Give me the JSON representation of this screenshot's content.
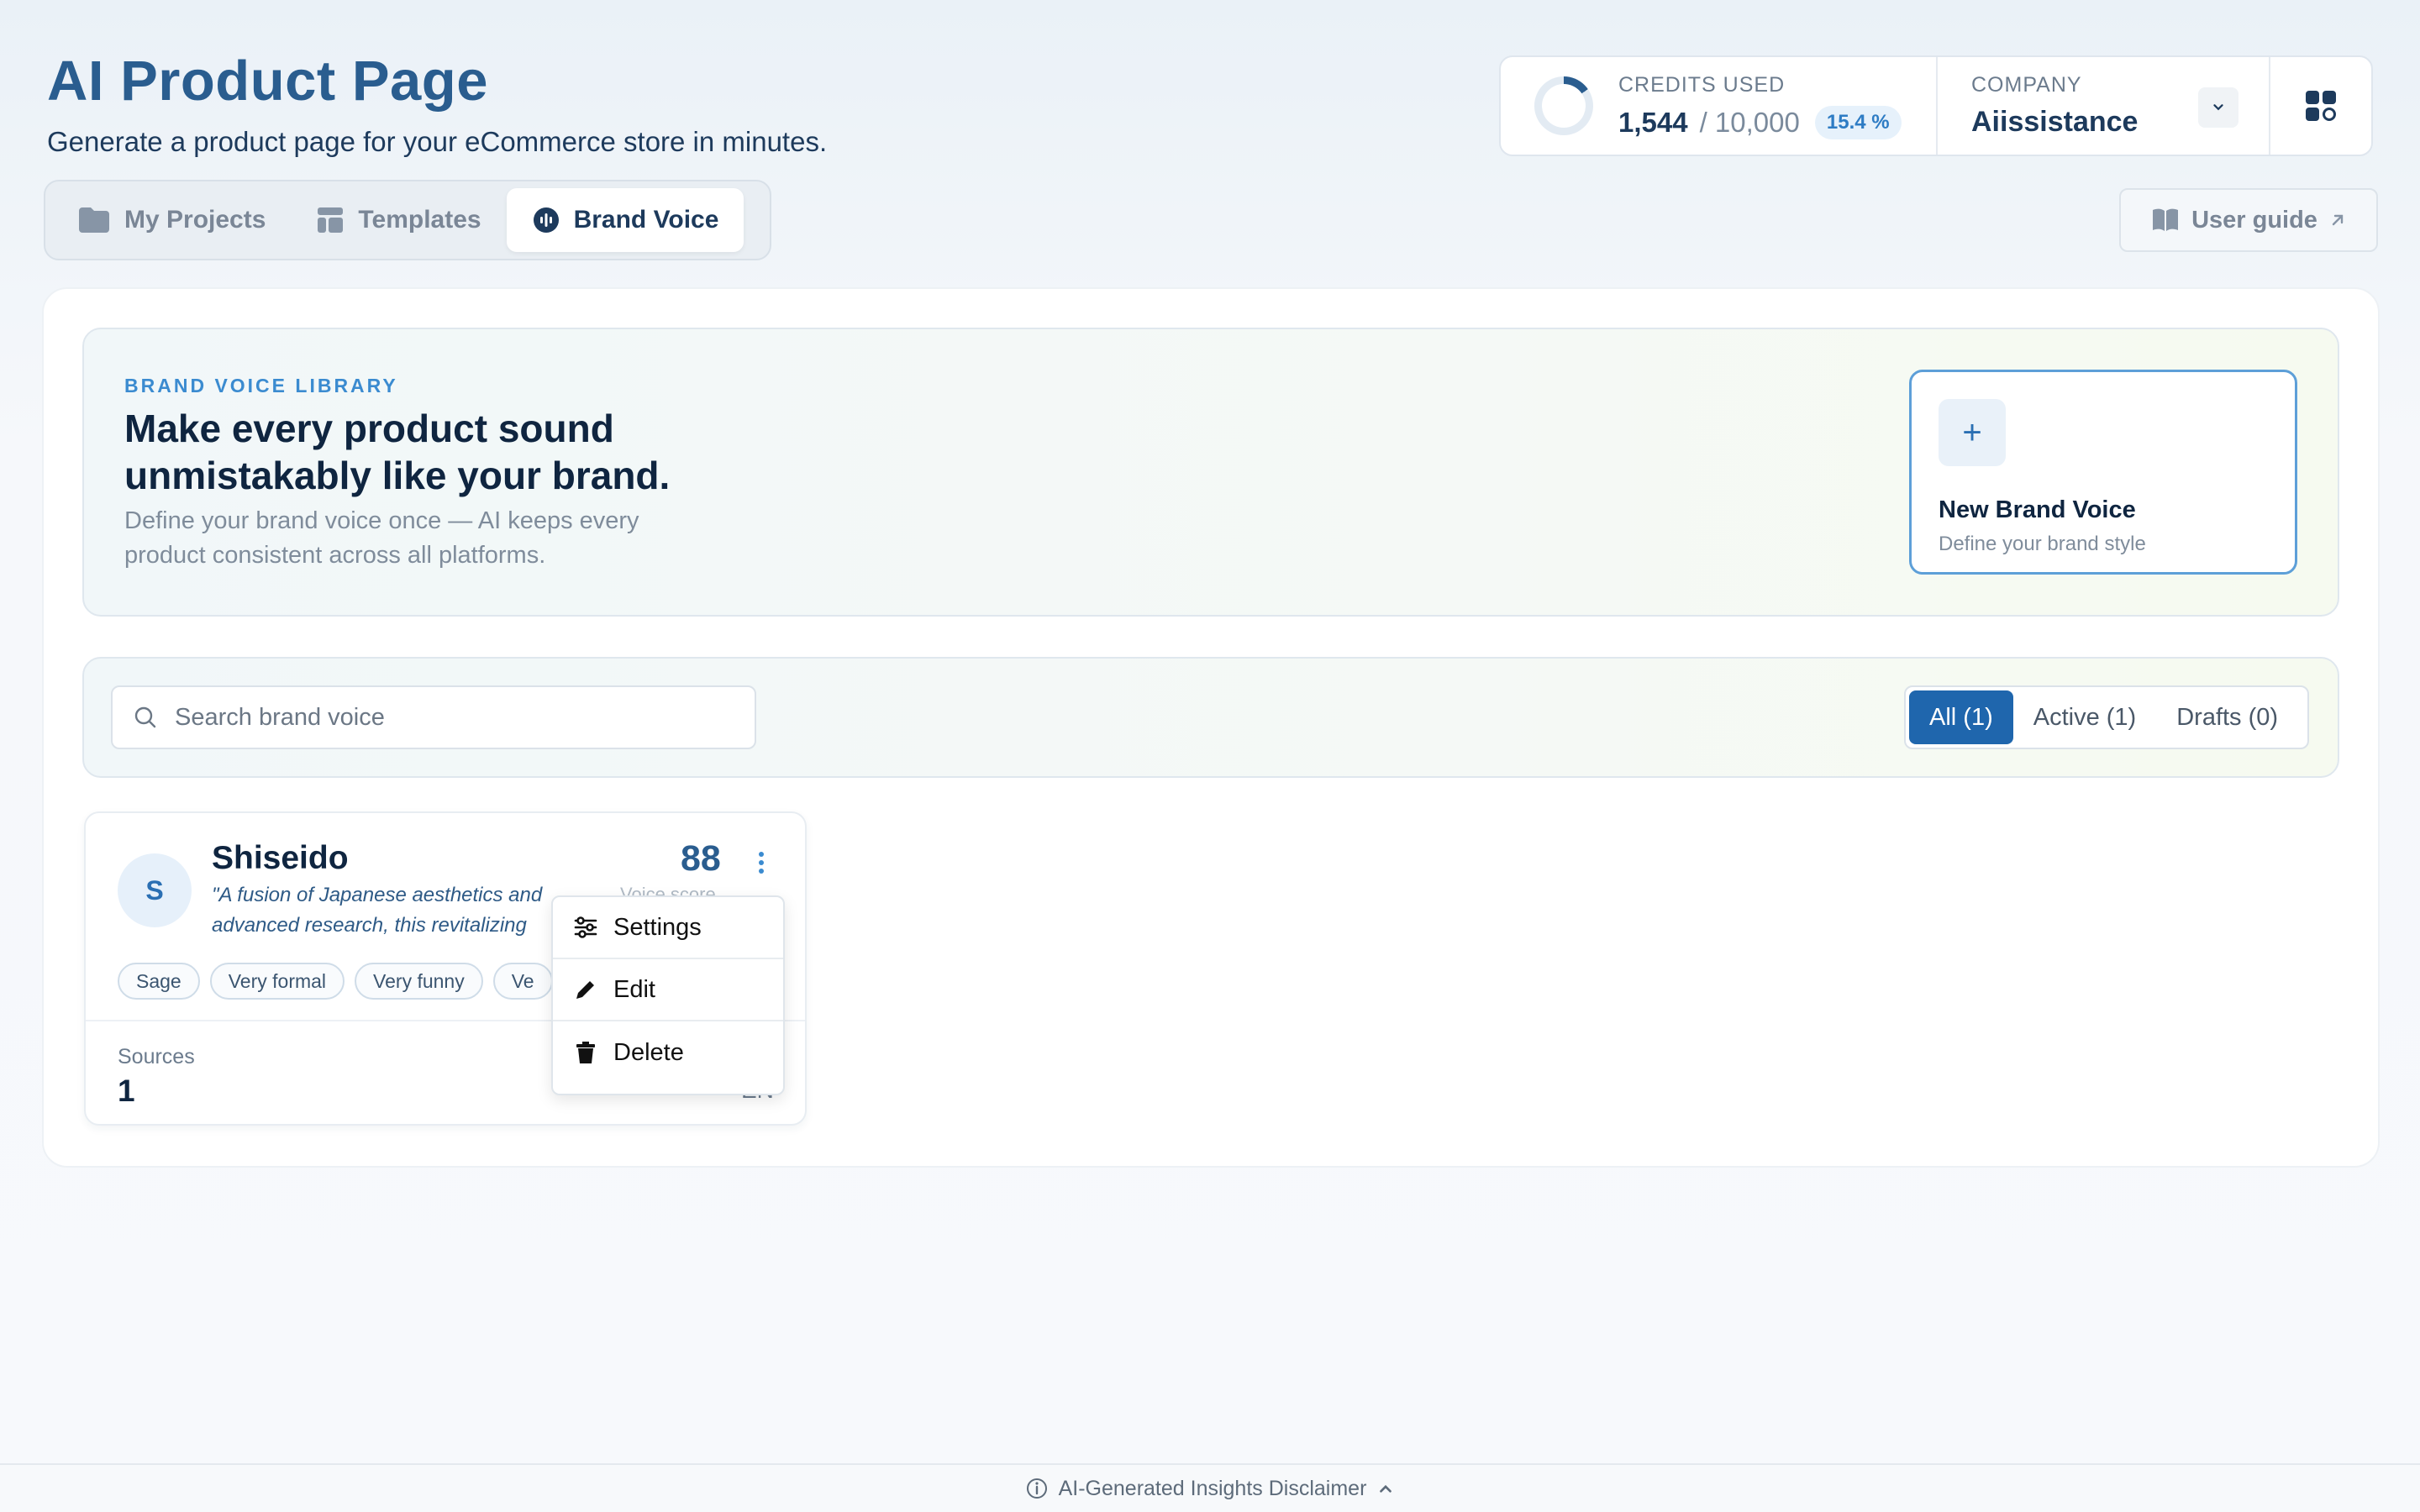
{
  "header": {
    "title": "AI Product Page",
    "subtitle": "Generate a product page for your eCommerce store in minutes."
  },
  "credits": {
    "label": "CREDITS USED",
    "used": "1,544",
    "total": "/ 10,000",
    "percent_label": "15.4 %",
    "percent_value": 0.154
  },
  "company": {
    "label": "COMPANY",
    "name": "Aiissistance"
  },
  "tabs": [
    {
      "label": "My Projects",
      "icon": "folder-icon",
      "active": false
    },
    {
      "label": "Templates",
      "icon": "template-icon",
      "active": false
    },
    {
      "label": "Brand Voice",
      "icon": "voice-icon",
      "active": true
    }
  ],
  "user_guide": {
    "label": "User guide"
  },
  "hero": {
    "tag": "BRAND VOICE LIBRARY",
    "heading_line1": "Make every product sound",
    "heading_line2": "unmistakably like your brand.",
    "desc_line1": "Define your brand voice once — AI keeps every",
    "desc_line2": "product consistent across all platforms."
  },
  "new_brand_voice": {
    "plus": "+",
    "title": "New Brand Voice",
    "subtitle": "Define your brand style"
  },
  "search": {
    "placeholder": "Search brand voice",
    "value": ""
  },
  "filters": [
    {
      "label": "All (1)",
      "active": true
    },
    {
      "label": "Active (1)",
      "active": false
    },
    {
      "label": "Drafts (0)",
      "active": false
    }
  ],
  "card": {
    "avatar": "S",
    "name": "Shiseido",
    "quote_line1": "\"A fusion of Japanese aesthetics and",
    "quote_line2": "advanced research, this revitalizing",
    "score": "88",
    "score_label": "Voice score",
    "chips": [
      "Sage",
      "Very formal",
      "Very funny",
      "Ve"
    ],
    "sources_label": "Sources",
    "sources_value": "1",
    "language": "EN"
  },
  "context_menu": {
    "settings": "Settings",
    "edit": "Edit",
    "delete": "Delete"
  },
  "footer": {
    "label": "AI-Generated Insights Disclaimer"
  },
  "colors": {
    "primary": "#2a5d8f",
    "accent": "#1f66ad",
    "highlight_border": "#5d9fd8"
  }
}
